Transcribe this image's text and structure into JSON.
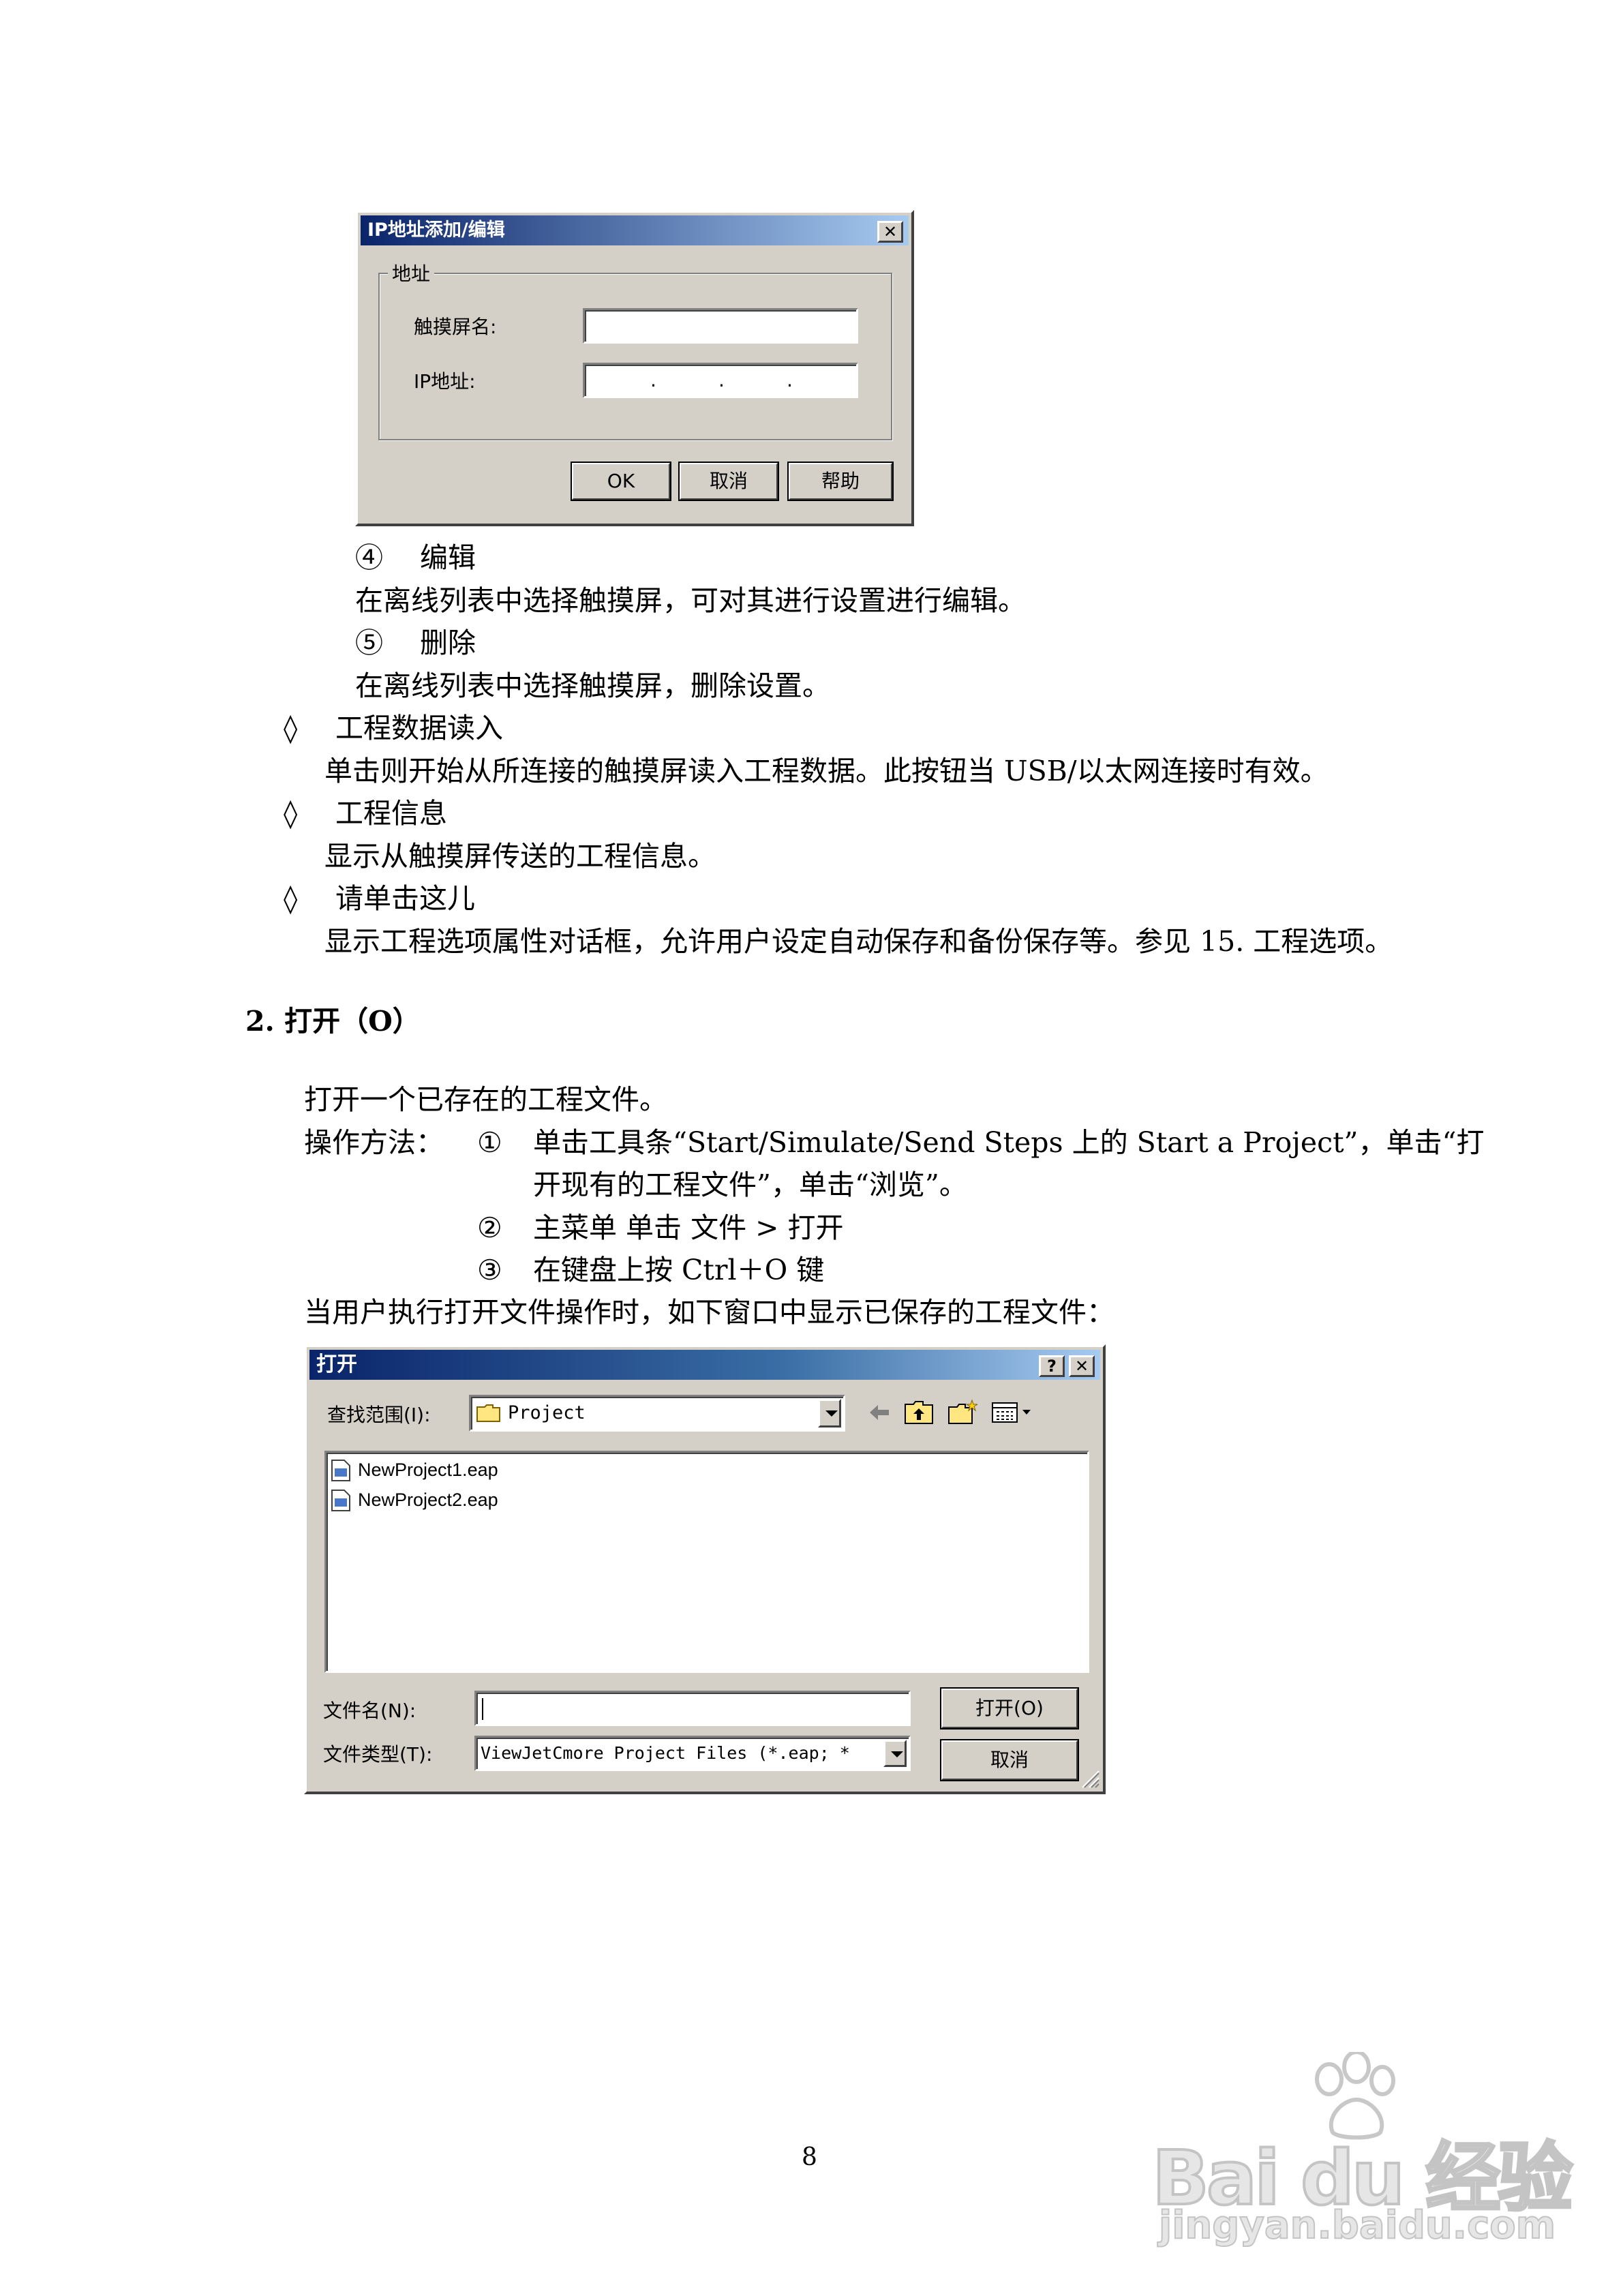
{
  "ip_dialog": {
    "title": "IP地址添加/编辑",
    "close": "✕",
    "group_label": "地址",
    "name_label": "触摸屏名:",
    "ip_label": "IP地址:",
    "ip_dots": [
      ".",
      ".",
      "."
    ],
    "ok": "OK",
    "cancel": "取消",
    "help": "帮助"
  },
  "body": {
    "edit_heading": "④　 编辑",
    "edit_desc": "在离线列表中选择触摸屏，可对其进行设置进行编辑。",
    "delete_heading": "⑤　 删除",
    "delete_desc": "在离线列表中选择触摸屏，删除设置。",
    "bullets": [
      {
        "mark": "◊",
        "title": "工程数据读入",
        "desc": "单击则开始从所连接的触摸屏读入工程数据。此按钮当 USB/以太网连接时有效。"
      },
      {
        "mark": "◊",
        "title": "工程信息",
        "desc": "显示从触摸屏传送的工程信息。"
      },
      {
        "mark": "◊",
        "title": "请单击这儿",
        "desc": "显示工程选项属性对话框，允许用户设定自动保存和备份保存等。参见 15. 工程选项。"
      }
    ],
    "section_title": "2. 打开（O）",
    "open_intro": "打开一个已存在的工程文件。",
    "method_label": "操作方法：",
    "steps": [
      {
        "num": "①",
        "text": "单击工具条“Start/Simulate/Send Steps 上的 Start a Project”，单击“打"
      },
      {
        "num": "",
        "text": "开现有的工程文件”，单击“浏览”。"
      },
      {
        "num": "②",
        "text": "主菜单  单击  文件  >  打开"
      },
      {
        "num": "③",
        "text": "在键盘上按 Ctrl＋O 键"
      }
    ],
    "open_note": "当用户执行打开文件操作时，如下窗口中显示已保存的工程文件："
  },
  "open_dialog": {
    "title": "打开",
    "help_btn": "?",
    "close_btn": "✕",
    "look_in_label": "查找范围(I):",
    "look_in_value": "Project",
    "files": [
      "NewProject1.eap",
      "NewProject2.eap"
    ],
    "filename_label": "文件名(N):",
    "filename_value": "",
    "filetype_label": "文件类型(T):",
    "filetype_value": "ViewJetCmore Project Files (*.eap; *",
    "open_button": "打开(O)",
    "cancel_button": "取消"
  },
  "page_number": "8",
  "watermark": {
    "logo": "Bai du 经验",
    "url": "jingyan.baidu.com"
  }
}
